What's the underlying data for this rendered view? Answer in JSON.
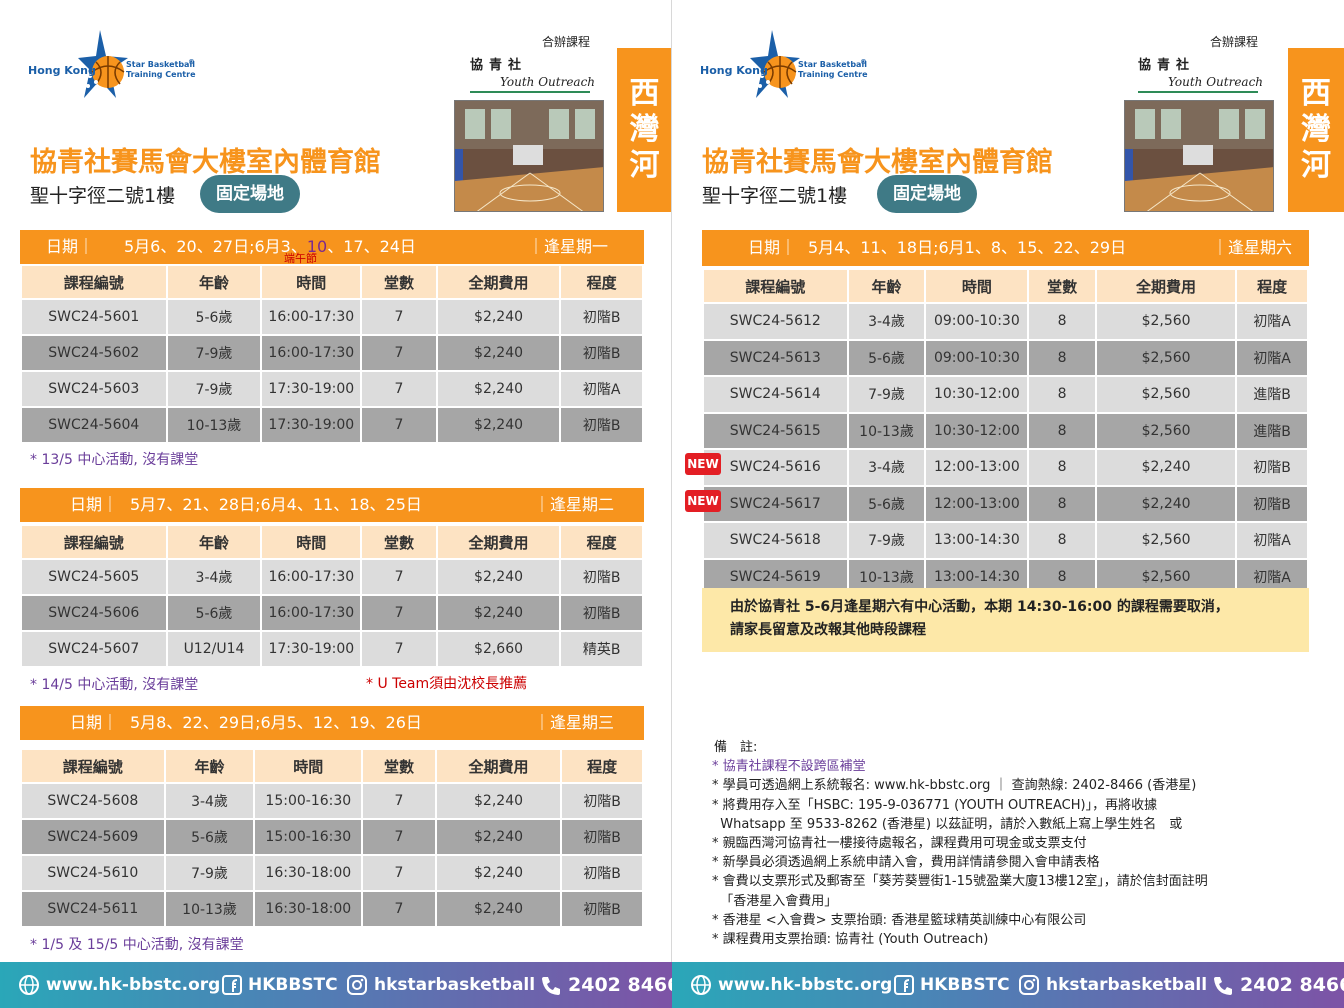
{
  "brand": {
    "hk": "Hong Kong",
    "star_line1": "Star Basketball",
    "star_line2": "Training Centre",
    "reg": "®",
    "cohost_label": "合辦課程",
    "yo_cn": "協青社",
    "yo_en": "Youth Outreach"
  },
  "colors": {
    "orange": "#f7941d",
    "header_peach": "#fde3c3",
    "row_light": "#dcdcdc",
    "row_dark": "#a6a6a6",
    "pill_teal": "#3f7a86",
    "new_red": "#e31e24"
  },
  "venue": {
    "name": "協青社賽馬會大樓室內體育館",
    "address": "聖十字徑二號1樓",
    "tag": "固定場地",
    "district": "西灣河"
  },
  "table_headers": [
    "課程編號",
    "年齡",
    "時間",
    "堂數",
    "全期費用",
    "程度"
  ],
  "left": {
    "blocks": [
      {
        "date_label": "日期｜",
        "dates_a": "5月6、20、27日;6月3、",
        "dates_highlight": "10",
        "dates_b": "、17、24日",
        "day": "｜逢星期一",
        "sub_label": "端午節",
        "rows": [
          [
            "SWC24-5601",
            "5-6歲",
            "16:00-17:30",
            "7",
            "$2,240",
            "初階B"
          ],
          [
            "SWC24-5602",
            "7-9歲",
            "16:00-17:30",
            "7",
            "$2,240",
            "初階B"
          ],
          [
            "SWC24-5603",
            "7-9歲",
            "17:30-19:00",
            "7",
            "$2,240",
            "初階A"
          ],
          [
            "SWC24-5604",
            "10-13歲",
            "17:30-19:00",
            "7",
            "$2,240",
            "初階B"
          ]
        ],
        "note": "* 13/5 中心活動, 沒有課堂",
        "note2": ""
      },
      {
        "date_label": "日期｜",
        "dates_a": "5月7、21、28日;6月4、11、18、25日",
        "dates_highlight": "",
        "dates_b": "",
        "day": "｜逢星期二",
        "sub_label": "",
        "rows": [
          [
            "SWC24-5605",
            "3-4歲",
            "16:00-17:30",
            "7",
            "$2,240",
            "初階B"
          ],
          [
            "SWC24-5606",
            "5-6歲",
            "16:00-17:30",
            "7",
            "$2,240",
            "初階B"
          ],
          [
            "SWC24-5607",
            "U12/U14",
            "17:30-19:00",
            "7",
            "$2,660",
            "精英B"
          ]
        ],
        "note": "* 14/5 中心活動, 沒有課堂",
        "note2": "* U Team須由沈校長推薦"
      },
      {
        "date_label": "日期｜",
        "dates_a": "5月8、22、29日;6月5、12、19、26日",
        "dates_highlight": "",
        "dates_b": "",
        "day": "｜逢星期三",
        "sub_label": "",
        "rows": [
          [
            "SWC24-5608",
            "3-4歲",
            "15:00-16:30",
            "7",
            "$2,240",
            "初階B"
          ],
          [
            "SWC24-5609",
            "5-6歲",
            "15:00-16:30",
            "7",
            "$2,240",
            "初階B"
          ],
          [
            "SWC24-5610",
            "7-9歲",
            "16:30-18:00",
            "7",
            "$2,240",
            "初階B"
          ],
          [
            "SWC24-5611",
            "10-13歲",
            "16:30-18:00",
            "7",
            "$2,240",
            "初階B"
          ]
        ],
        "note": "* 1/5 及 15/5 中心活動, 沒有課堂",
        "note2": ""
      }
    ]
  },
  "right": {
    "date_label": "日期｜",
    "dates": "5月4、11、18日;6月1、8、15、22、29日",
    "day": "｜逢星期六",
    "new_label": "NEW",
    "rows": [
      [
        "SWC24-5612",
        "3-4歲",
        "09:00-10:30",
        "8",
        "$2,560",
        "初階A"
      ],
      [
        "SWC24-5613",
        "5-6歲",
        "09:00-10:30",
        "8",
        "$2,560",
        "初階A"
      ],
      [
        "SWC24-5614",
        "7-9歲",
        "10:30-12:00",
        "8",
        "$2,560",
        "進階B"
      ],
      [
        "SWC24-5615",
        "10-13歲",
        "10:30-12:00",
        "8",
        "$2,560",
        "進階B"
      ],
      [
        "SWC24-5616",
        "3-4歲",
        "12:00-13:00",
        "8",
        "$2,240",
        "初階B"
      ],
      [
        "SWC24-5617",
        "5-6歲",
        "12:00-13:00",
        "8",
        "$2,240",
        "初階B"
      ],
      [
        "SWC24-5618",
        "7-9歲",
        "13:00-14:30",
        "8",
        "$2,560",
        "初階A"
      ],
      [
        "SWC24-5619",
        "10-13歲",
        "13:00-14:30",
        "8",
        "$2,560",
        "初階A"
      ]
    ],
    "notice_line1": "由於協青社 5-6月逢星期六有中心活動，本期 14:30-16:00 的課程需要取消，",
    "notice_line2": "請家長留意及改報其他時段課程"
  },
  "remarks": {
    "title": "備　註:",
    "lines": [
      "* 協青社課程不設跨區補堂",
      "* 學員可透過網上系統報名: www.hk-bbstc.org ｜ 查詢熱線: 2402-8466 (香港星)",
      "* 將費用存入至「HSBC: 195-9-036771 (YOUTH OUTREACH)」，再將收據",
      "  Whatsapp 至 9533-8262 (香港星) 以茲証明，請於入數紙上寫上學生姓名　或",
      "* 親臨西灣河協青社一樓接待處報名，課程費用可現金或支票支付",
      "* 新學員必須透過網上系統申請入會，費用詳情請參閱入會申請表格",
      "* 會費以支票形式及郵寄至「葵芳葵豐街1-15號盈業大廈13樓12室」，請於信封面註明",
      "  「香港星入會費用」",
      "* 香港星 <入會費> 支票抬頭: 香港星籃球精英訓練中心有限公司",
      "* 課程費用支票抬頭: 協青社 (Youth Outreach)"
    ]
  },
  "footer": {
    "website": "www.hk-bbstc.org",
    "facebook": "HKBBSTC",
    "instagram": "hkstarbasketball",
    "phone": "2402 8466"
  }
}
